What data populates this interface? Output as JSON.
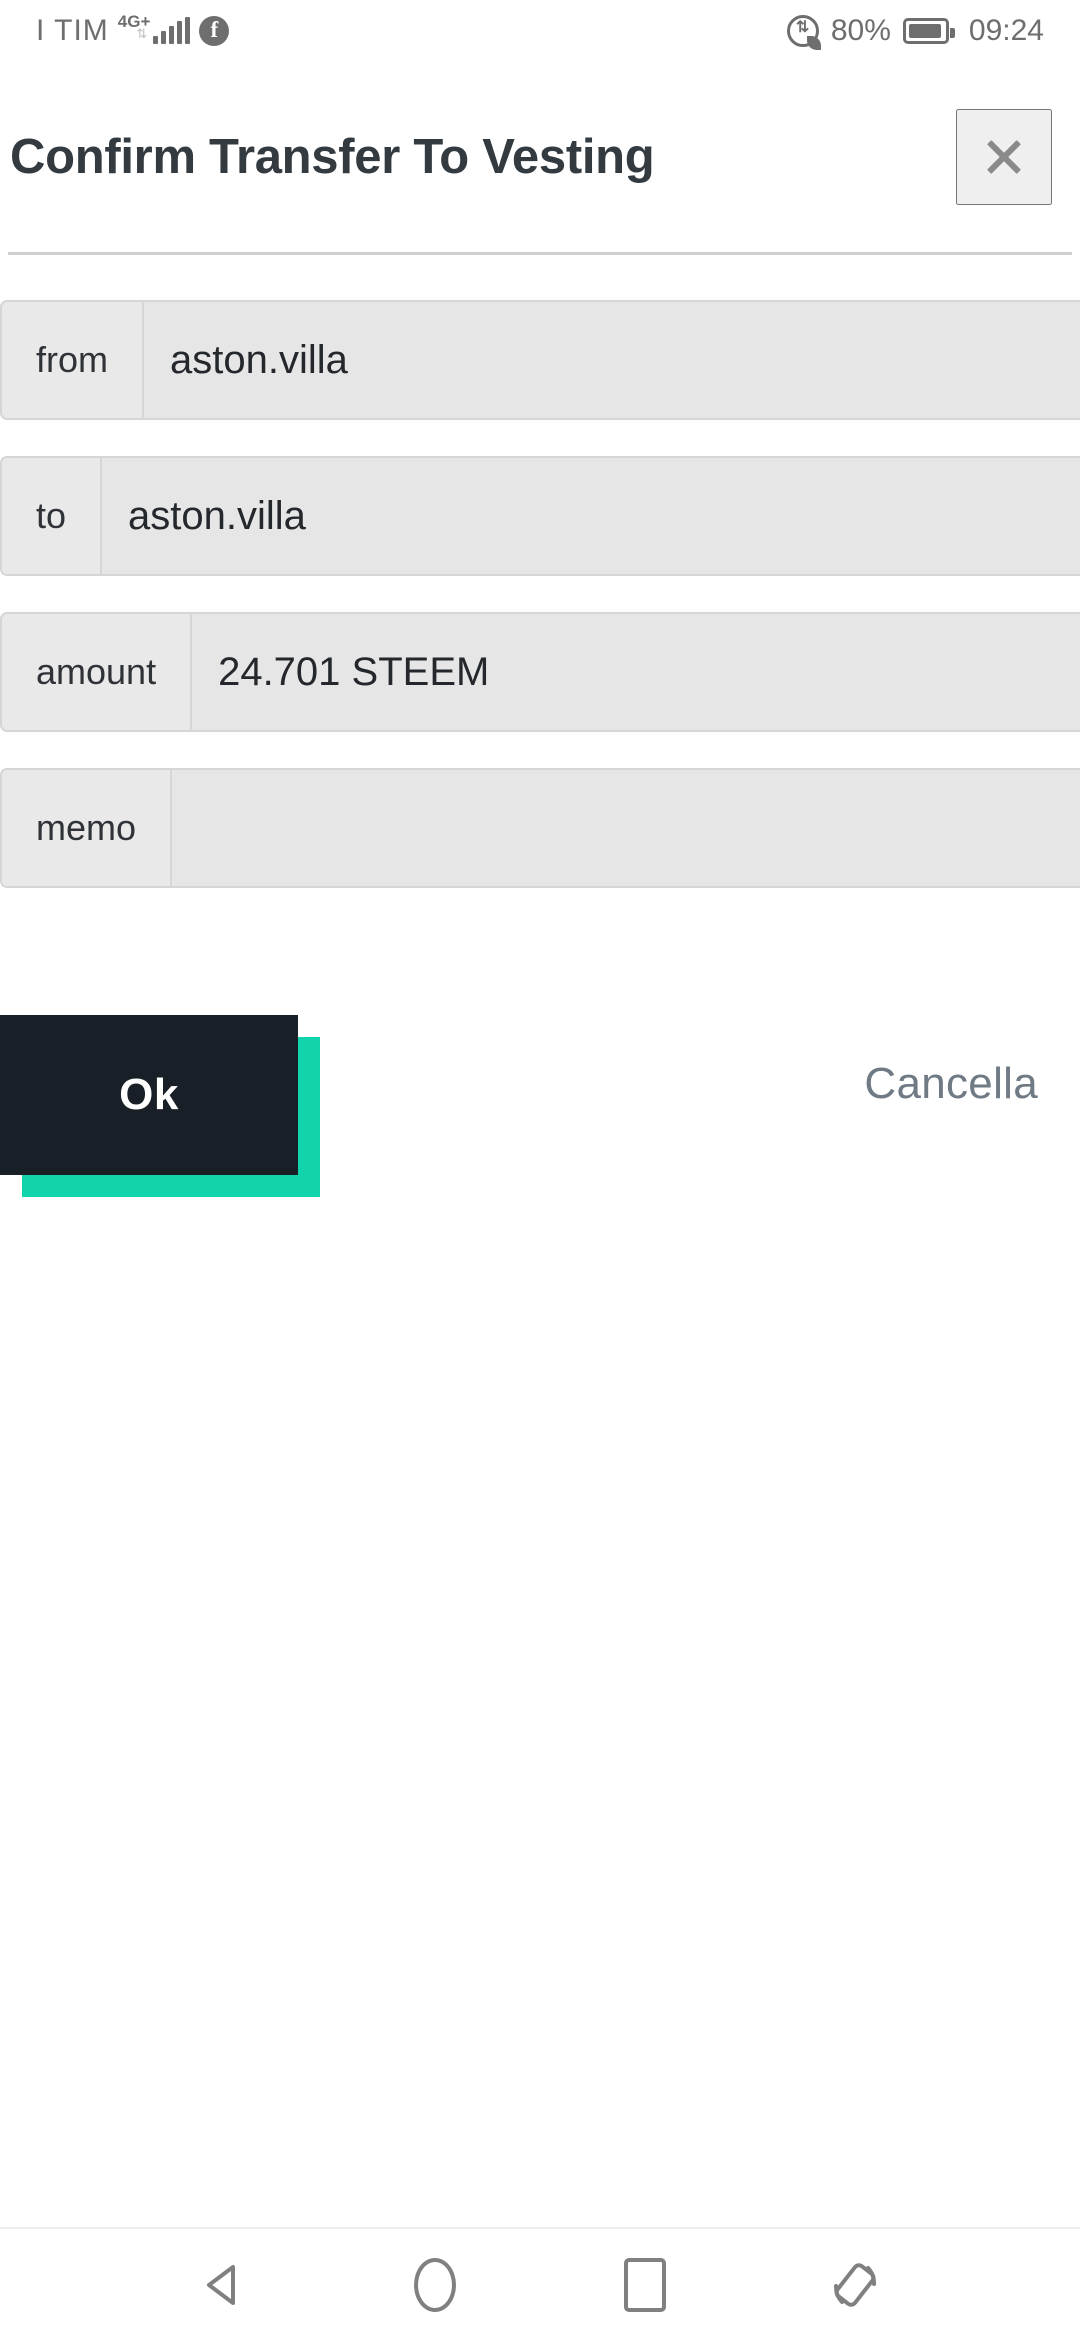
{
  "status_bar": {
    "carrier": "I TIM",
    "network_type": "4G+",
    "signal_icon": "signal-bars-icon",
    "notification_icon": "facebook-icon",
    "data_saver_icon": "data-saver-icon",
    "battery_percent": "80%",
    "battery_icon": "battery-icon",
    "clock": "09:24"
  },
  "dialog": {
    "title": "Confirm Transfer To Vesting",
    "close_icon": "close-icon",
    "fields": [
      {
        "label": "from",
        "value": "aston.villa"
      },
      {
        "label": "to",
        "value": "aston.villa"
      },
      {
        "label": "amount",
        "value": "24.701 STEEM"
      },
      {
        "label": "memo",
        "value": ""
      }
    ],
    "confirm_label": "Ok",
    "cancel_label": "Cancella"
  },
  "colors": {
    "confirm_background": "#181f26",
    "confirm_shadow": "#12d4ac",
    "confirm_text": "#ffffff",
    "cancel_text": "#6f7a85",
    "field_background": "#e6e6e6",
    "field_border": "#d6d6d6",
    "title_text": "#333a40",
    "status_text": "#6e6e6e"
  },
  "nav_bar": {
    "back_icon": "back-triangle-icon",
    "home_icon": "home-circle-icon",
    "recents_icon": "recents-square-icon",
    "rotate_icon": "rotate-screen-icon"
  }
}
